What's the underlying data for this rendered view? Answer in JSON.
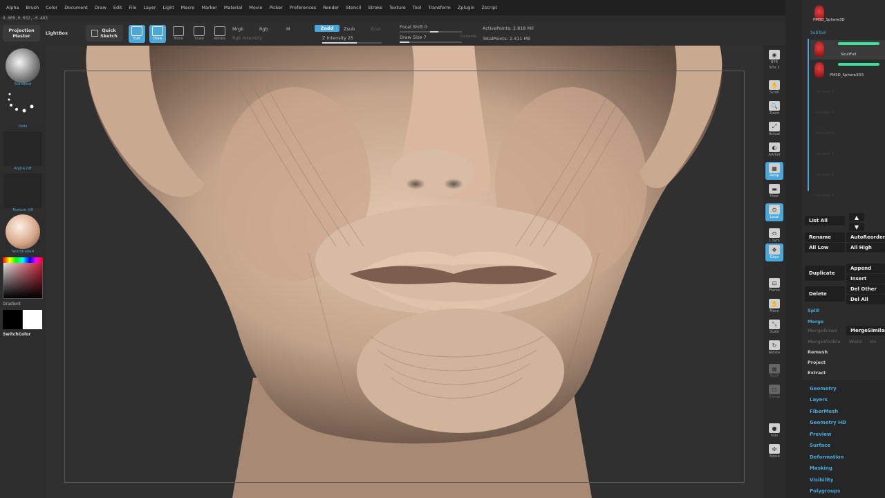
{
  "menu": [
    "Alpha",
    "Brush",
    "Color",
    "Document",
    "Draw",
    "Edit",
    "File",
    "Layer",
    "Light",
    "Macro",
    "Marker",
    "Material",
    "Movie",
    "Picker",
    "Preferences",
    "Render",
    "Stencil",
    "Stroke",
    "Texture",
    "Tool",
    "Transform",
    "Zplugin",
    "Zscript"
  ],
  "coords": "0.009,0.032,-0.403",
  "toolbar": {
    "projection_master": "Projection\nMaster",
    "lightbox": "LightBox",
    "quick_sketch": "Quick\nSketch",
    "edit": "Edit",
    "draw": "Draw",
    "move": "Move",
    "scale": "Scale",
    "rotate": "Rotate",
    "mrgb": "Mrgb",
    "rgb": "Rgb",
    "m": "M",
    "rgb_intensity": "Rgb Intensity",
    "zadd": "Zadd",
    "zsub": "Zsub",
    "zcut": "Zcut",
    "z_intensity": "Z Intensity 25",
    "focal_shift": "Focal Shift 0",
    "draw_size": "Draw Size 7",
    "dynamic": "Dynamic",
    "active_points": "ActivePoints: 2.818 Mil",
    "total_points": "TotalPoints: 2.411 Mil"
  },
  "toolbar_values": {
    "z_intensity": 25,
    "focal_shift": 0,
    "draw_size": 7
  },
  "left": {
    "brush": "Standard",
    "stroke": "Dots",
    "alpha": "Alpha Off",
    "texture": "Texture Off",
    "material": "SkinShade4",
    "gradient": "Gradient",
    "switch": "SwitchColor"
  },
  "right_shelf": [
    {
      "id": "bpr",
      "label": "BPR"
    },
    {
      "id": "spix",
      "label": "SPix 3"
    },
    {
      "id": "scroll",
      "label": "Scroll"
    },
    {
      "id": "zoom",
      "label": "Zoom"
    },
    {
      "id": "actual",
      "label": "Actual"
    },
    {
      "id": "aahalf",
      "label": "AAHalf"
    },
    {
      "id": "persp",
      "label": "Persp"
    },
    {
      "id": "floor",
      "label": "Floor"
    },
    {
      "id": "local",
      "label": "Local"
    },
    {
      "id": "lsym",
      "label": "L.Sym"
    },
    {
      "id": "xyz",
      "label": "Gxyz"
    },
    {
      "id": "frame",
      "label": "Frame"
    },
    {
      "id": "move",
      "label": "Move"
    },
    {
      "id": "scale",
      "label": "Scale"
    },
    {
      "id": "rotate",
      "label": "Rotate"
    },
    {
      "id": "polyf",
      "label": "PolyF"
    },
    {
      "id": "transp",
      "label": "Transp"
    },
    {
      "id": "solo",
      "label": "Solo"
    },
    {
      "id": "xpose",
      "label": "Xpose"
    }
  ],
  "subtool": {
    "title": "SubTool",
    "top_item": "PM3D_Sphere3D",
    "items": [
      "SkullFull",
      "PM3D_Sphere3D3"
    ],
    "empty": [
      "Unused 2",
      "Unused 3",
      "Unused 4",
      "Unused 5",
      "Unused 6",
      "Unused 7"
    ],
    "list_all": "List All",
    "rename": "Rename",
    "auto_reorder": "AutoReorder",
    "all_low": "All Low",
    "all_high": "All High",
    "duplicate": "Duplicate",
    "append": "Append",
    "insert": "Insert",
    "delete": "Delete",
    "del_other": "Del Other",
    "del_all": "Del All",
    "split": "Split",
    "merge": "Merge",
    "merge_down": "MergeDown",
    "merge_similar": "MergeSimilar",
    "merge_visible": "MergeVisible",
    "weld": "Weld",
    "uv": "Uv",
    "remesh": "Remesh",
    "project": "Project",
    "extract": "Extract"
  },
  "sections": [
    "Geometry",
    "Layers",
    "FiberMesh",
    "Geometry HD",
    "Preview",
    "Surface",
    "Deformation",
    "Masking",
    "Visibility",
    "Polygroups"
  ],
  "colors": {
    "accent": "#4aa7d8",
    "green": "#3ee0a0",
    "skin": "#c9ab92"
  }
}
